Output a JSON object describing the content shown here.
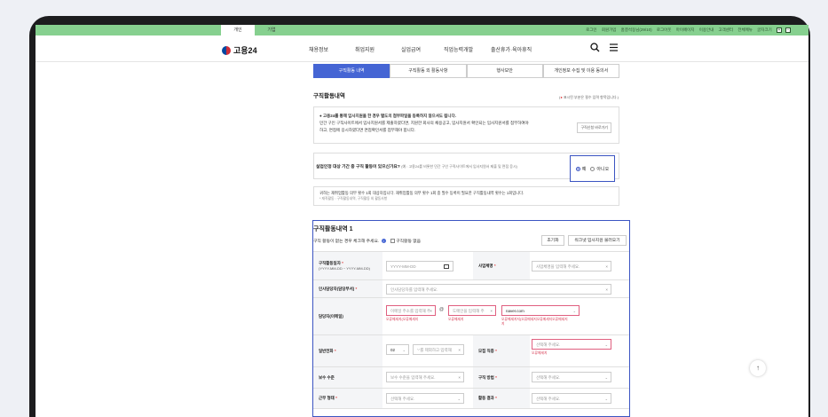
{
  "topbar": {
    "tabs": [
      "개인",
      "기업"
    ],
    "links": [
      "로그인",
      "회원가입",
      "홈결석동님(29/10)",
      "로그아웃",
      "마이페이지",
      "이용안내",
      "고객센터",
      "전체메뉴",
      "글자크기"
    ],
    "zoom_plus": "+",
    "zoom_minus": "−"
  },
  "header": {
    "logo": "고용24",
    "nav": [
      "채용정보",
      "취업지원",
      "실업급여",
      "직업능력개발",
      "출산휴가·육아휴직"
    ],
    "search_icon": "search-icon",
    "menu_icon": "hamburger-icon"
  },
  "tabs": [
    "구직활동 내역",
    "구직활동 외 활동사항",
    "행사보안",
    "개인정보 수집 및 이용 동의서"
  ],
  "section": {
    "title": "구직활동내역",
    "required_note_star": "●",
    "required_note": "표시된 부분은 필수 입력 항목입니다."
  },
  "notice": {
    "line1": "● 고용24를 통해 입사지원을 한 경우 별도의 첨부파일을 등록하지 않으셔도 됩니다.",
    "line2": "민간 구인 구직사이트에서 입사지원서를 제출하였다면, 지원한 회사의 채용공고, 입사지원서 확인되는 입사지원서를 첨부하여야",
    "line3": "하고, 면접에 응시하였다면 면접확인서를 첨부해야 합니다.",
    "button": "구직신청 바로가기"
  },
  "question": {
    "text": "실업인정 대상 기간 중 구직 활동이 있으신가요?",
    "hint": "(예 : 고용24를 비롯한 민간 구인 구직사이트에서 입사지원서 제출 및 면접 응시)",
    "yes": "예",
    "no": "아니오",
    "selected": "예"
  },
  "info": {
    "line": "귀하는 재취업활동 의무 횟수 1회 대상자입니다. 재취업활동 의무 횟수 1회 중 필수 등록이 필요한 구직활동내역 횟수는 1회입니다.",
    "sub": "* 재직활동 : 구직활동내역, 구직활동 외 활동사항"
  },
  "activity": {
    "title": "구직활동내역 1",
    "hint": "구직 활동이 없는 경우 체크해 주세요.",
    "info_icon": "i",
    "no_activity_label": "구직활동 없음",
    "reset_button": "초기화",
    "load_button": "워크넷 입사지원 불러오기",
    "fields": {
      "date_label": "구직활동일자",
      "date_sub": "(YYYY-MM-DD ~ YYYY-MM-DD)",
      "date_placeholder": "YYYY-MM-DD",
      "company_label": "사업체명",
      "company_placeholder": "사업체명을 입력해 주세요.",
      "manager_label": "인사담당자(담당부서)",
      "manager_placeholder": "인사담당자를 입력해 주세요.",
      "email_label": "담당자(이메일)",
      "email_id_placeholder": "이메일 주소를 입력해 주",
      "email_at": "@",
      "email_domain_placeholder": "도메인을 입력해 주",
      "email_domain_select": "naver.com",
      "email_err1": "오류메세지(오류메세지",
      "email_err2": "오류메세지",
      "email_err3": "오류메세지지(오류메세지오류메세지오류메세지",
      "email_err3b": "지",
      "phone_label": "일반전화",
      "phone_prefix": "02",
      "phone_placeholder": "'-'를 제외하고 입력해",
      "job_label": "모집 직종",
      "job_placeholder": "선택해 주세요.",
      "job_err": "오류메세지",
      "salary_label": "보수 수준",
      "salary_placeholder": "보수 수준을 입력해 주세요.",
      "method_label": "구직 방법",
      "method_placeholder": "선택해 주세요.",
      "work_label": "근무 형태",
      "work_placeholder": "선택해 주세요.",
      "result_label": "활동 결과",
      "result_placeholder": "선택해 주세요.",
      "required_mark": "*"
    }
  },
  "scroll_top": "↑"
}
